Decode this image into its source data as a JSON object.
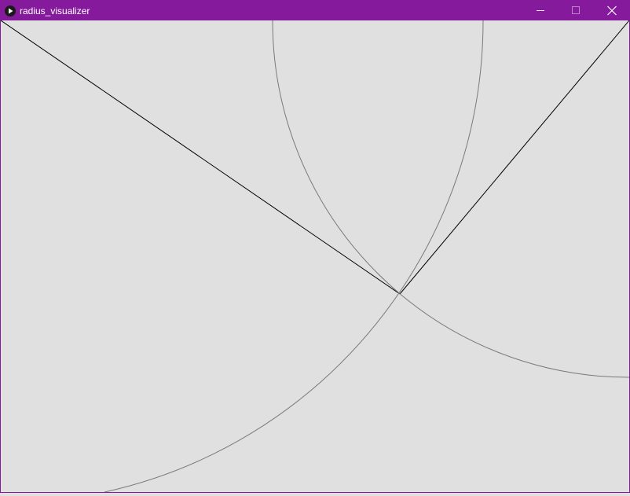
{
  "window": {
    "title": "radius_visualizer",
    "app_icon": "play-icon",
    "controls": {
      "minimize_icon": "minimize-icon",
      "maximize_icon": "maximize-icon",
      "close_icon": "close-icon"
    }
  },
  "colors": {
    "titlebar": "#861a9c",
    "title_text": "#ffffff",
    "canvas_background": "#e0e0e0",
    "lines": "#000000",
    "arcs": "#7a7a7a"
  },
  "sketch": {
    "description_items": [
      "line-left",
      "line-right",
      "arc-upper-circle",
      "arc-lower-circle"
    ]
  }
}
